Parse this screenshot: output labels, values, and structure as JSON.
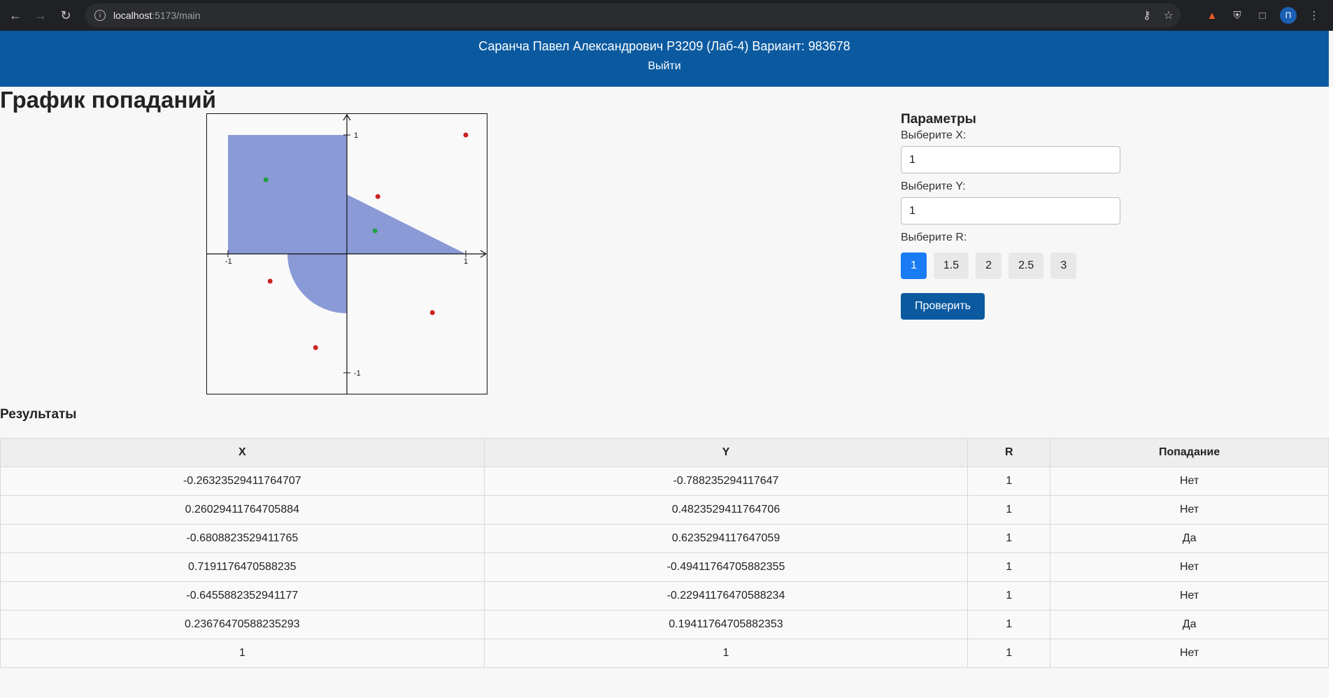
{
  "browser": {
    "url_host": "localhost",
    "url_rest": ":5173/main",
    "avatar_letter": "П"
  },
  "header": {
    "title": "Саранча Павел Александрович P3209 (Лаб-4) Вариант: 983678",
    "logout_label": "Выйти",
    "color": "#0b5aa0"
  },
  "page_title": "График попаданий",
  "graph": {
    "r": 1,
    "ticks": {
      "x_neg": "-1",
      "x_pos": "1",
      "y_pos": "1",
      "y_neg": "-1"
    },
    "area_color": "#8a9ad6",
    "hit_color": "#22a046",
    "miss_color": "#cc2222"
  },
  "params": {
    "title": "Параметры",
    "x_label": "Выберите X:",
    "x_value": "1",
    "y_label": "Выберите Y:",
    "y_value": "1",
    "r_label": "Выберите R:",
    "r_options": [
      "1",
      "1.5",
      "2",
      "2.5",
      "3"
    ],
    "r_selected": "1",
    "submit_label": "Проверить"
  },
  "results": {
    "title": "Результаты",
    "columns": [
      "X",
      "Y",
      "R",
      "Попадание"
    ],
    "rows": [
      [
        "-0.26323529411764707",
        "-0.788235294117647",
        "1",
        "Нет"
      ],
      [
        "0.26029411764705884",
        "0.4823529411764706",
        "1",
        "Нет"
      ],
      [
        "-0.6808823529411765",
        "0.6235294117647059",
        "1",
        "Да"
      ],
      [
        "0.7191176470588235",
        "-0.49411764705882355",
        "1",
        "Нет"
      ],
      [
        "-0.6455882352941177",
        "-0.22941176470588234",
        "1",
        "Нет"
      ],
      [
        "0.23676470588235293",
        "0.19411764705882353",
        "1",
        "Да"
      ],
      [
        "1",
        "1",
        "1",
        "Нет"
      ]
    ]
  }
}
